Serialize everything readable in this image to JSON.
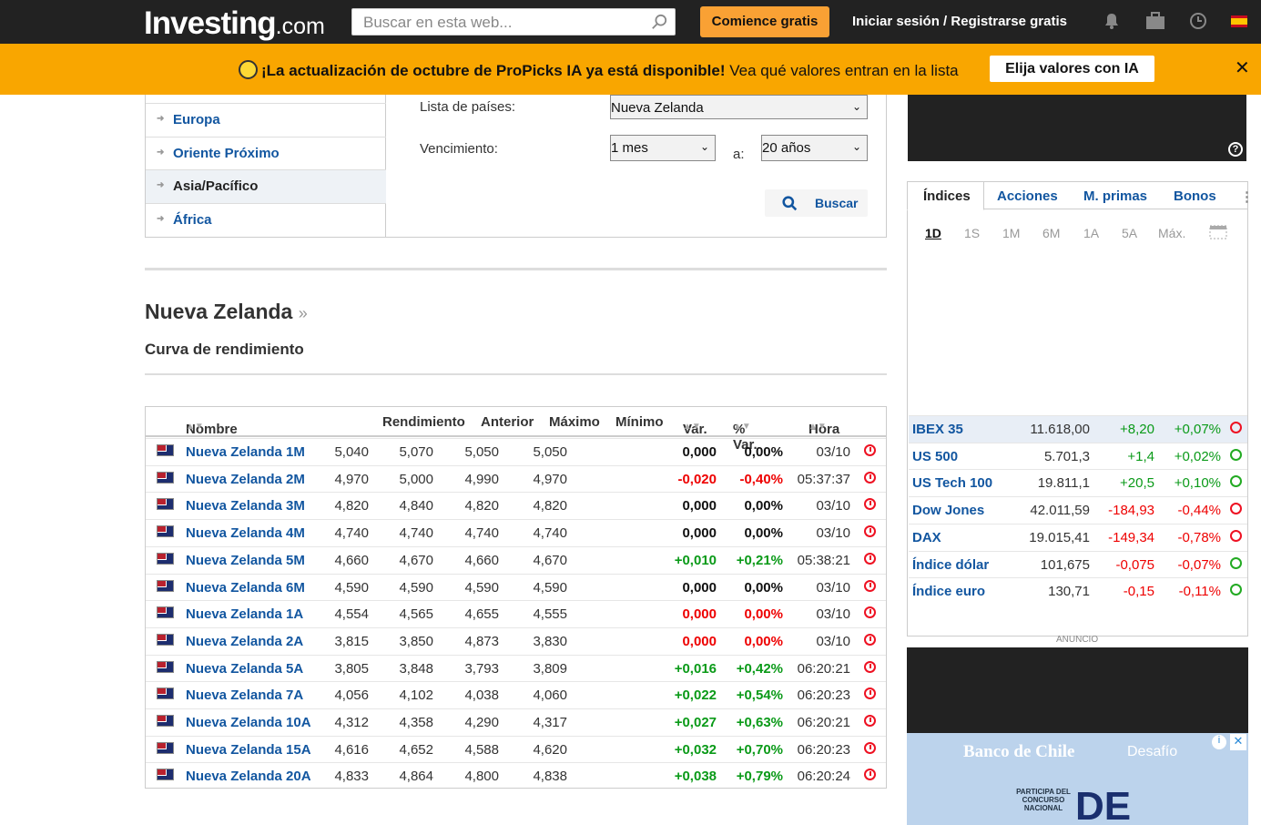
{
  "header": {
    "logo_main": "Investing",
    "logo_suffix": ".com",
    "search_placeholder": "Buscar en esta web...",
    "start_button": "Comience gratis",
    "login": "Iniciar sesión",
    "sep": "/",
    "register": "Registrarse gratis"
  },
  "banner": {
    "text_bold": "¡La actualización de octubre de ProPicks IA ya está disponible!",
    "text_rest": "Vea qué valores entran en la lista",
    "button": "Elija valores con IA",
    "close": "✕"
  },
  "regions": [
    "Europa",
    "Oriente Próximo",
    "Asia/Pacífico",
    "África"
  ],
  "form": {
    "countries_label": "Lista de países:",
    "country_value": "Nueva Zelanda",
    "maturity_label": "Vencimiento:",
    "from_value": "1 mes",
    "to_label": "a:",
    "to_value": "20 años",
    "search_button": "Buscar"
  },
  "page_title": "Nueva Zelanda",
  "page_title_raquo": "»",
  "subtitle": "Curva de rendimiento",
  "table": {
    "headers": {
      "name": "Nombre",
      "yield": "Rendimiento",
      "prev": "Anterior",
      "high": "Máximo",
      "low": "Mínimo",
      "chg": "Var.",
      "pct": "% Var.",
      "time": "Hora"
    },
    "rows": [
      {
        "name": "Nueva Zelanda 1M",
        "yield": "5,050",
        "prev": "5,050",
        "high": "5,070",
        "low": "5,040",
        "chg": "0,000",
        "pct": "0,00%",
        "time": "03/10",
        "dir": "neu"
      },
      {
        "name": "Nueva Zelanda 2M",
        "yield": "4,970",
        "prev": "4,990",
        "high": "5,000",
        "low": "4,970",
        "chg": "-0,020",
        "pct": "-0,40%",
        "time": "05:37:37",
        "dir": "neg"
      },
      {
        "name": "Nueva Zelanda 3M",
        "yield": "4,820",
        "prev": "4,820",
        "high": "4,840",
        "low": "4,820",
        "chg": "0,000",
        "pct": "0,00%",
        "time": "03/10",
        "dir": "neu"
      },
      {
        "name": "Nueva Zelanda 4M",
        "yield": "4,740",
        "prev": "4,740",
        "high": "4,740",
        "low": "4,740",
        "chg": "0,000",
        "pct": "0,00%",
        "time": "03/10",
        "dir": "neu"
      },
      {
        "name": "Nueva Zelanda 5M",
        "yield": "4,670",
        "prev": "4,660",
        "high": "4,670",
        "low": "4,660",
        "chg": "+0,010",
        "pct": "+0,21%",
        "time": "05:38:21",
        "dir": "pos"
      },
      {
        "name": "Nueva Zelanda 6M",
        "yield": "4,590",
        "prev": "4,590",
        "high": "4,590",
        "low": "4,590",
        "chg": "0,000",
        "pct": "0,00%",
        "time": "03/10",
        "dir": "neu"
      },
      {
        "name": "Nueva Zelanda 1A",
        "yield": "4,555",
        "prev": "4,655",
        "high": "4,565",
        "low": "4,554",
        "chg": "0,000",
        "pct": "0,00%",
        "time": "03/10",
        "dir": "neg"
      },
      {
        "name": "Nueva Zelanda 2A",
        "yield": "3,830",
        "prev": "4,873",
        "high": "3,850",
        "low": "3,815",
        "chg": "0,000",
        "pct": "0,00%",
        "time": "03/10",
        "dir": "neg"
      },
      {
        "name": "Nueva Zelanda 5A",
        "yield": "3,809",
        "prev": "3,793",
        "high": "3,848",
        "low": "3,805",
        "chg": "+0,016",
        "pct": "+0,42%",
        "time": "06:20:21",
        "dir": "pos"
      },
      {
        "name": "Nueva Zelanda 7A",
        "yield": "4,060",
        "prev": "4,038",
        "high": "4,102",
        "low": "4,056",
        "chg": "+0,022",
        "pct": "+0,54%",
        "time": "06:20:23",
        "dir": "pos"
      },
      {
        "name": "Nueva Zelanda 10A",
        "yield": "4,317",
        "prev": "4,290",
        "high": "4,358",
        "low": "4,312",
        "chg": "+0,027",
        "pct": "+0,63%",
        "time": "06:20:21",
        "dir": "pos"
      },
      {
        "name": "Nueva Zelanda 15A",
        "yield": "4,620",
        "prev": "4,588",
        "high": "4,652",
        "low": "4,616",
        "chg": "+0,032",
        "pct": "+0,70%",
        "time": "06:20:23",
        "dir": "pos"
      },
      {
        "name": "Nueva Zelanda 20A",
        "yield": "4,838",
        "prev": "4,800",
        "high": "4,864",
        "low": "4,833",
        "chg": "+0,038",
        "pct": "+0,79%",
        "time": "06:20:24",
        "dir": "pos"
      }
    ]
  },
  "widget": {
    "tabs": [
      "Índices",
      "Acciones",
      "M. primas",
      "Bonos"
    ],
    "periods": [
      "1D",
      "1S",
      "1M",
      "6M",
      "1A",
      "5A",
      "Máx."
    ],
    "indices": [
      {
        "name": "IBEX 35",
        "value": "11.618,00",
        "chg": "+8,20",
        "pct": "+0,07%",
        "dir": "pos",
        "clock": "red"
      },
      {
        "name": "US 500",
        "value": "5.701,3",
        "chg": "+1,4",
        "pct": "+0,02%",
        "dir": "pos",
        "clock": "green"
      },
      {
        "name": "US Tech 100",
        "value": "19.811,1",
        "chg": "+20,5",
        "pct": "+0,10%",
        "dir": "pos",
        "clock": "green"
      },
      {
        "name": "Dow Jones",
        "value": "42.011,59",
        "chg": "-184,93",
        "pct": "-0,44%",
        "dir": "neg",
        "clock": "red"
      },
      {
        "name": "DAX",
        "value": "19.015,41",
        "chg": "-149,34",
        "pct": "-0,78%",
        "dir": "neg",
        "clock": "red"
      },
      {
        "name": "Índice dólar",
        "value": "101,675",
        "chg": "-0,075",
        "pct": "-0,07%",
        "dir": "neg",
        "clock": "green"
      },
      {
        "name": "Índice euro",
        "value": "130,71",
        "chg": "-0,15",
        "pct": "-0,11%",
        "dir": "neg",
        "clock": "green"
      }
    ]
  },
  "ad_label": "ANUNCIO",
  "ad_help": "?",
  "ad_close": "✕",
  "ad_brand": "Banco de Chile",
  "ad_partner": "Desafío",
  "ad_sub": "PARTICIPA DEL CONCURSO NACIONAL",
  "ad_big": "DE",
  "colors": {
    "accent": "#f9a134",
    "link": "#1256a0",
    "positive": "#0a9a18",
    "negative": "#e00000"
  }
}
